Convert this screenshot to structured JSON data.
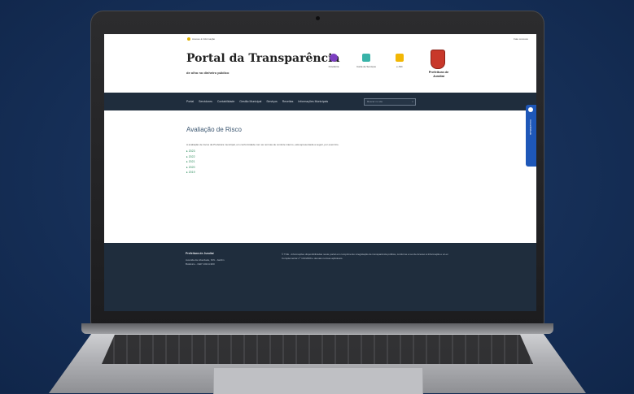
{
  "site": {
    "topbar": {
      "access_link": "Acesso à Informação",
      "right_link": "Fale conosco"
    },
    "title": "Portal da Transparência",
    "subtitle": "de olho no dinheiro público",
    "quick_links": [
      {
        "label": "Ouvidoria",
        "color": "#7c3fc0"
      },
      {
        "label": "Carta de Serviços",
        "color": "#39b3a8"
      },
      {
        "label": "e-SIC",
        "color": "#f2b705"
      }
    ],
    "crest_label": "Prefeitura de Jundiaí",
    "nav": [
      "Portal",
      "Servidores",
      "Contabilidade",
      "Gestão Municipal",
      "Serviços",
      "Receitas",
      "Informações Municipais"
    ],
    "search_placeholder": "Buscar no site",
    "search_icon": "search-icon",
    "page_title": "Avaliação de Risco",
    "page_description": "A avaliação de riscos da Prefeitura municipal, em conformidade com as normas de controle interno, está apresentada a seguir, por exercício.",
    "years": [
      "2023",
      "2022",
      "2021",
      "2020",
      "2019"
    ],
    "footer": {
      "name": "Prefeitura de Jundiaí",
      "address": "Avenida da Liberdade, S/N - Jardim Botânico - CEP 13214-900",
      "text": "© TCE - Informações disponibilizadas neste portal em cumprimento à legislação de transparência pública, conforme a Lei de Acesso à Informação e a Lei Complementar nº 131/2009 e demais normas aplicáveis."
    },
    "side_tab_label": "Acessibilidade"
  }
}
